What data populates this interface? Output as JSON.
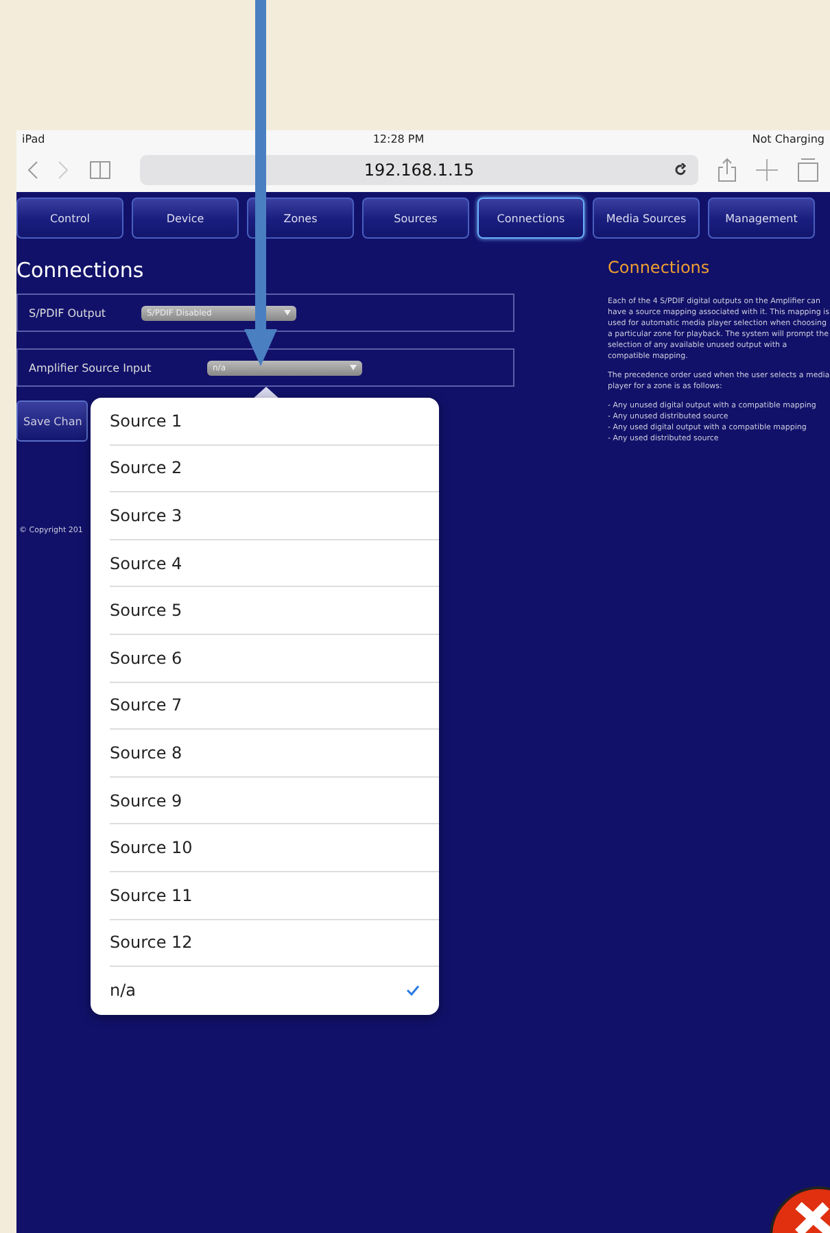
{
  "status_bar": {
    "device": "iPad",
    "time": "12:28 PM",
    "battery": "Not Charging"
  },
  "browser": {
    "url": "192.168.1.15"
  },
  "tabs": [
    {
      "label": "Control",
      "selected": false
    },
    {
      "label": "Device",
      "selected": false
    },
    {
      "label": "Zones",
      "selected": false
    },
    {
      "label": "Sources",
      "selected": false
    },
    {
      "label": "Connections",
      "selected": true
    },
    {
      "label": "Media Sources",
      "selected": false
    },
    {
      "label": "Management",
      "selected": false
    }
  ],
  "page": {
    "title": "Connections",
    "settings": [
      {
        "label": "S/PDIF Output",
        "value": "S/PDIF Disabled"
      },
      {
        "label": "Amplifier Source Input",
        "value": "n/a"
      }
    ],
    "save_button": "Save Chan",
    "copyright": "© Copyright 201"
  },
  "help": {
    "title": "Connections",
    "paragraphs": [
      "Each of the 4 S/PDIF digital outputs on the Amplifier can have a source mapping associated with it. This mapping is used for automatic media player selection when choosing a particular zone for playback. The system will prompt the selection of any available unused output with a compatible mapping.",
      "The precedence order used when the user selects a media player for a zone is as follows:"
    ],
    "bullets": [
      "- Any unused digital output with a compatible mapping",
      "- Any unused distributed source",
      "- Any used digital output with a compatible mapping",
      "- Any used distributed source"
    ]
  },
  "dropdown": {
    "options": [
      {
        "label": "Source 1",
        "selected": false
      },
      {
        "label": "Source 2",
        "selected": false
      },
      {
        "label": "Source 3",
        "selected": false
      },
      {
        "label": "Source 4",
        "selected": false
      },
      {
        "label": "Source 5",
        "selected": false
      },
      {
        "label": "Source 6",
        "selected": false
      },
      {
        "label": "Source 7",
        "selected": false
      },
      {
        "label": "Source 8",
        "selected": false
      },
      {
        "label": "Source 9",
        "selected": false
      },
      {
        "label": "Source 10",
        "selected": false
      },
      {
        "label": "Source 11",
        "selected": false
      },
      {
        "label": "Source 12",
        "selected": false
      },
      {
        "label": "n/a",
        "selected": true
      }
    ]
  }
}
